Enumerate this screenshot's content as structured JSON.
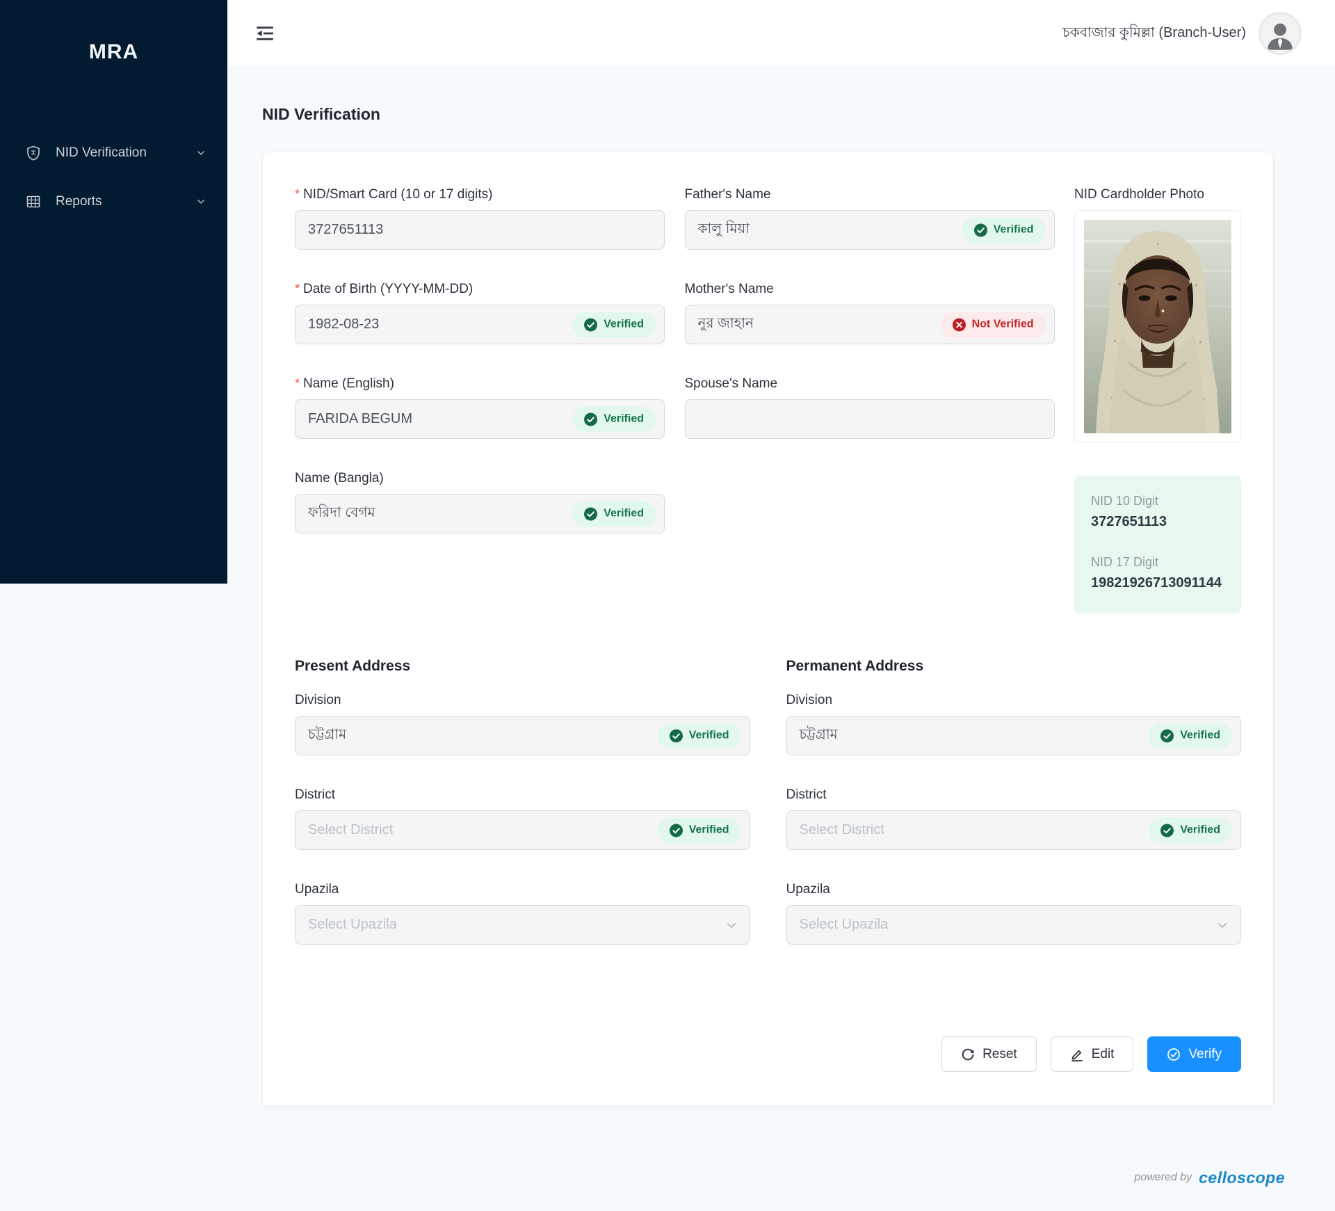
{
  "sidebar": {
    "logo": "MRA",
    "items": [
      {
        "label": "NID Verification",
        "icon": "shield-id-icon"
      },
      {
        "label": "Reports",
        "icon": "table-grid-icon"
      }
    ]
  },
  "header": {
    "user_label": "চকবাজার কুমিল্লা (Branch-User)"
  },
  "page": {
    "title": "NID Verification",
    "required_marker": "*"
  },
  "form": {
    "nid_card": {
      "label": "NID/Smart Card (10 or 17 digits)",
      "value": "3727651113"
    },
    "date_of_birth": {
      "label": "Date of Birth (YYYY-MM-DD)",
      "value": "1982-08-23",
      "status": "Verified"
    },
    "name_english": {
      "label": "Name (English)",
      "value": "FARIDA BEGUM",
      "status": "Verified"
    },
    "name_bangla": {
      "label": "Name (Bangla)",
      "value": "ফরিদা বেগম",
      "status": "Verified"
    },
    "fathers_name": {
      "label": "Father's Name",
      "value": "কালু মিয়া",
      "status": "Verified"
    },
    "mothers_name": {
      "label": "Mother's Name",
      "value": "নুর জাহান",
      "status": "Not Verified"
    },
    "spouses_name": {
      "label": "Spouse's Name",
      "value": ""
    }
  },
  "photo": {
    "title": "NID Cardholder Photo"
  },
  "nid_summary": {
    "ten_digit_label": "NID 10 Digit",
    "ten_digit_value": "3727651113",
    "seventeen_digit_label": "NID 17 Digit",
    "seventeen_digit_value": "19821926713091144"
  },
  "present_address": {
    "title": "Present Address",
    "division": {
      "label": "Division",
      "value": "চট্টগ্রাম",
      "status": "Verified"
    },
    "district": {
      "label": "District",
      "placeholder": "Select District",
      "status": "Verified"
    },
    "upazila": {
      "label": "Upazila",
      "placeholder": "Select Upazila"
    }
  },
  "permanent_address": {
    "title": "Permanent Address",
    "division": {
      "label": "Division",
      "value": "চট্টগ্রাম",
      "status": "Verified"
    },
    "district": {
      "label": "District",
      "placeholder": "Select District",
      "status": "Verified"
    },
    "upazila": {
      "label": "Upazila",
      "placeholder": "Select Upazila"
    }
  },
  "actions": {
    "reset": "Reset",
    "edit": "Edit",
    "verify": "Verify"
  },
  "footer": {
    "powered_by": "powered by",
    "brand": "celloscope"
  },
  "colors": {
    "sidebar_bg": "#031b30",
    "accent_blue": "#1890ff",
    "verified_bg": "#e3f8ec",
    "verified_text": "#17744a",
    "not_verified_bg": "#fdeaea",
    "not_verified_text": "#c2262c",
    "nid_box_bg": "#e9f8ef",
    "brand_blue": "#1687cd"
  }
}
